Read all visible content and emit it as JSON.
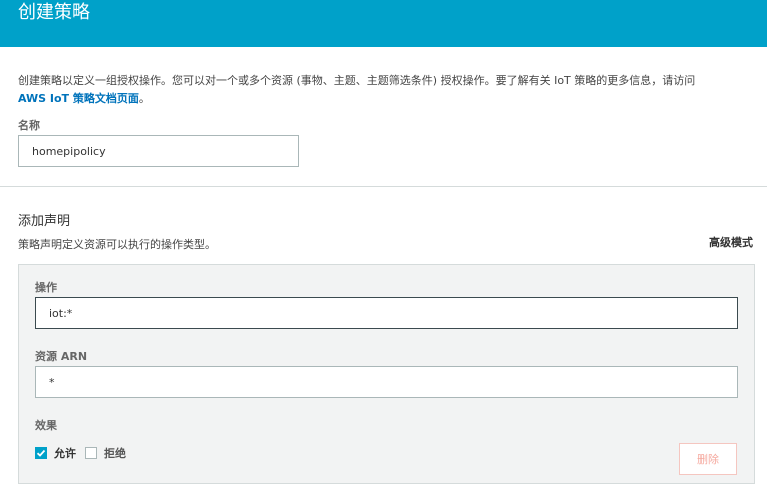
{
  "header": {
    "title": "创建策略"
  },
  "intro": {
    "text": "创建策略以定义一组授权操作。您可以对一个或多个资源 (事物、主题、主题筛选条件) 授权操作。要了解有关 IoT 策略的更多信息，请访问",
    "link_text": "AWS IoT 策略文档页面",
    "suffix": "。"
  },
  "name_field": {
    "label": "名称",
    "value": "homepipolicy"
  },
  "statement": {
    "title": "添加声明",
    "description": "策略声明定义资源可以执行的操作类型。",
    "advanced_mode": "高级模式",
    "action_label": "操作",
    "action_value": "iot:*",
    "resource_label": "资源 ARN",
    "resource_value": "*",
    "effect_label": "效果",
    "allow_label": "允许",
    "deny_label": "拒绝",
    "allow_checked": true,
    "deny_checked": false,
    "delete_label": "删除"
  },
  "colors": {
    "header_bg": "#00a1c9",
    "link": "#0073bb",
    "delete_text": "#f5a89e"
  }
}
